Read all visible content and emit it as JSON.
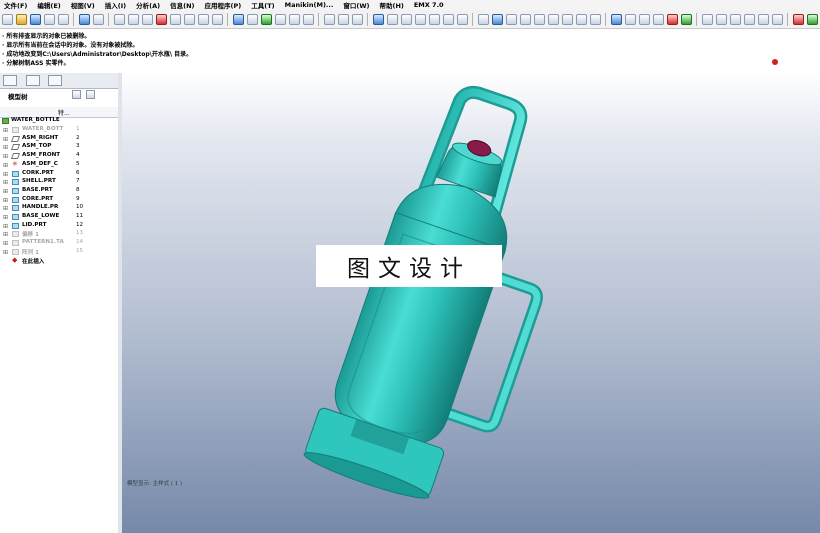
{
  "menu": {
    "items": [
      "文件(F)",
      "编辑(E)",
      "视图(V)",
      "插入(I)",
      "分析(A)",
      "信息(N)",
      "应用程序(P)",
      "工具(T)",
      "Manikin(M)...",
      "窗口(W)",
      "帮助(H)",
      "EMX 7.0"
    ]
  },
  "messages": [
    "· 所有排查显示的对象已被删除。",
    "· 显示所有当前在会话中的对象。没有对象被拭除。",
    "· 成功地改变到C:\\Users\\Administrator\\Desktop\\开水瓶\\ 目录。",
    "· 分解树制ASS  实零件。"
  ],
  "panel": {
    "title": "模型树",
    "column_header": "特..."
  },
  "tree": {
    "root": "WATER_BOTTLE",
    "items": [
      {
        "name": "WATER_BOTT",
        "num": "1",
        "icon": "part-icon",
        "dim": true
      },
      {
        "name": "ASM_RIGHT",
        "num": "2",
        "icon": "datum-plane-icon",
        "dim": false
      },
      {
        "name": "ASM_TOP",
        "num": "3",
        "icon": "datum-plane-icon",
        "dim": false
      },
      {
        "name": "ASM_FRONT",
        "num": "4",
        "icon": "datum-plane-icon",
        "dim": false
      },
      {
        "name": "ASM_DEF_C",
        "num": "5",
        "icon": "csys-icon",
        "dim": false
      },
      {
        "name": "CORK.PRT",
        "num": "6",
        "icon": "part-icon",
        "dim": false
      },
      {
        "name": "SHELL.PRT",
        "num": "7",
        "icon": "part-icon",
        "dim": false
      },
      {
        "name": "BASE.PRT",
        "num": "8",
        "icon": "part-icon",
        "dim": false
      },
      {
        "name": "CORE.PRT",
        "num": "9",
        "icon": "part-icon",
        "dim": false
      },
      {
        "name": "HANDLE.PR",
        "num": "10",
        "icon": "part-icon",
        "dim": false
      },
      {
        "name": "BASE_LOWE",
        "num": "11",
        "icon": "part-icon",
        "dim": false
      },
      {
        "name": "LID.PRT",
        "num": "12",
        "icon": "part-icon",
        "dim": false
      },
      {
        "name": "偏移 1",
        "num": "13",
        "icon": "part-icon",
        "dim": true
      },
      {
        "name": "PATTERN1.TA",
        "num": "14",
        "icon": "part-icon",
        "dim": true
      },
      {
        "name": "阵列 1",
        "num": "15",
        "icon": "part-icon",
        "dim": true
      }
    ],
    "insert_here": "在此插入"
  },
  "viewport": {
    "status_text": "模型显示:  主样式 ( 1 )",
    "watermark": "图文设计"
  },
  "colors": {
    "model_teal": "#2ec8c0",
    "model_dark": "#1a8f8a",
    "cork": "#8a1a4a"
  }
}
